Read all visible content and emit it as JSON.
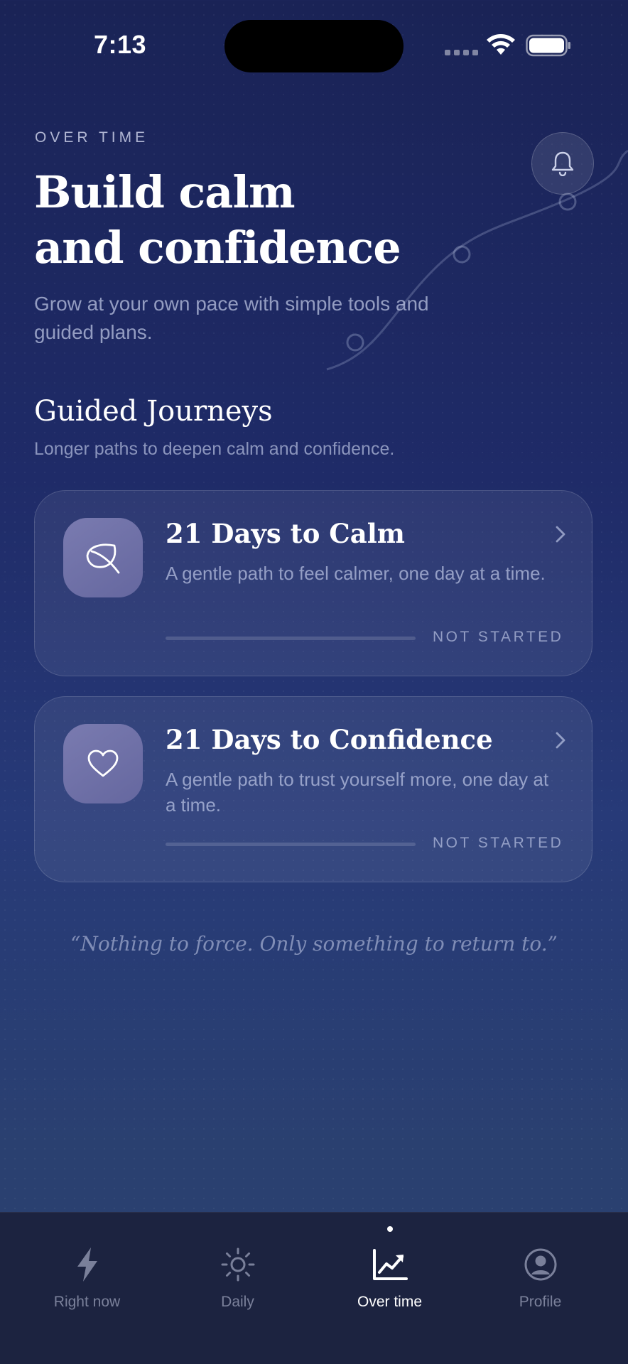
{
  "status_bar": {
    "time": "7:13"
  },
  "header": {
    "eyebrow": "OVER TIME",
    "title_line1": "Build calm",
    "title_line2": "and confidence",
    "subtitle": "Grow at your own pace with simple tools and guided plans.",
    "bell_icon": "bell-icon"
  },
  "section": {
    "title": "Guided Journeys",
    "subtitle": "Longer paths to deepen calm and confidence."
  },
  "journeys": [
    {
      "title": "21 Days to Calm",
      "description": "A gentle path to feel calmer, one day at a time.",
      "status": "NOT STARTED",
      "progress": 0,
      "icon": "leaf-icon"
    },
    {
      "title": "21 Days to Confidence",
      "description": "A gentle path to trust yourself more, one day at a time.",
      "status": "NOT STARTED",
      "progress": 0,
      "icon": "heart-icon"
    }
  ],
  "quote": "“Nothing to force. Only something to return to.”",
  "tabs": [
    {
      "label": "Right now",
      "icon": "lightning-icon",
      "active": false
    },
    {
      "label": "Daily",
      "icon": "sun-icon",
      "active": false
    },
    {
      "label": "Over time",
      "icon": "trend-chart-icon",
      "active": true
    },
    {
      "label": "Profile",
      "icon": "profile-icon",
      "active": false
    }
  ],
  "colors": {
    "background_top": "#1a2356",
    "background_bottom": "#2b4271",
    "tab_bar": "#1c2340",
    "card_icon": "#7a7bb0"
  }
}
